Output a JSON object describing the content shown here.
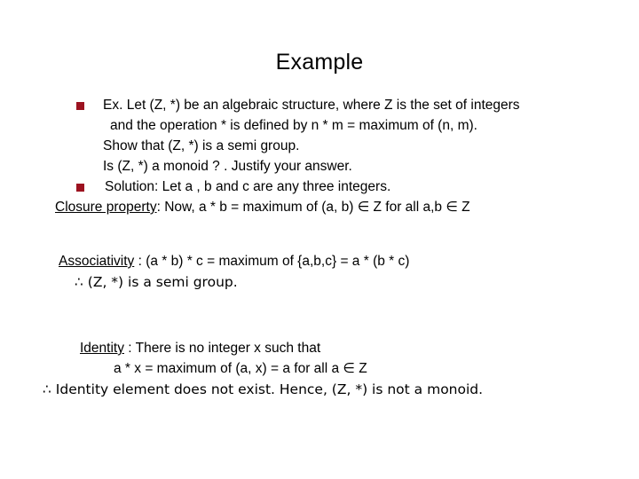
{
  "slide": {
    "title": "Example",
    "bullet_color": "#9C1220",
    "text_color": "#000000",
    "background": "#ffffff"
  },
  "content": {
    "block_a": {
      "bullet": "square-bullet",
      "lines": [
        "Ex. Let (Z, *) be an algebraic structure, where Z is the set of integers",
        "and  the operation * is  defined by     n * m  =  maximum of (n, m).",
        "Show that (Z, *) is a semi group.",
        "Is (Z, *) a monoid ? .  Justify your answer."
      ]
    },
    "block_b": {
      "bullet": "square-bullet",
      "line": "Solution:  Let a , b  and c  are any three integers."
    },
    "closure": {
      "label": "Closure property",
      "rest": ":  Now,  a * b =  maximum of (a, b) ∈ Z    for all a,b ∈ Z"
    },
    "associativity": {
      "label": "Associativity",
      "rest": " : (a * b) * c  =  maximum of {a,b,c} =  a * (b * c)",
      "conclusion": "∴ (Z, *) is a semi group."
    },
    "identity": {
      "label": "Identity",
      "rest": " :  There is no integer x such that",
      "equation": "a * x =  maximum of (a, x)  = a      for all a ∈ Z",
      "conclusion": "∴ Identity element does not exist. Hence, (Z, *) is not a monoid."
    }
  }
}
